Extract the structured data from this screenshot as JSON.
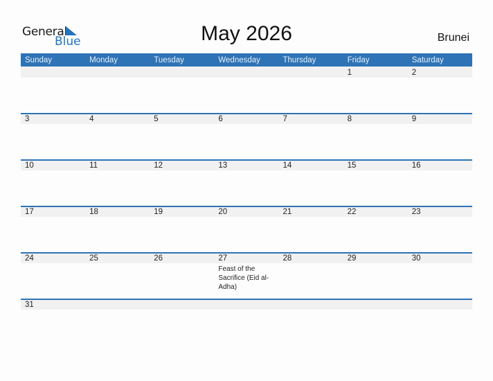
{
  "logo": {
    "word1": "General",
    "word2": "Blue",
    "icon": "triangle-flag-icon"
  },
  "title": "May 2026",
  "country": "Brunei",
  "colors": {
    "accent": "#2e73b5",
    "band": "#f1f1f1",
    "logo_blue": "#1f74c0"
  },
  "weekdays": [
    "Sunday",
    "Monday",
    "Tuesday",
    "Wednesday",
    "Thursday",
    "Friday",
    "Saturday"
  ],
  "weeks": [
    [
      {
        "d": ""
      },
      {
        "d": ""
      },
      {
        "d": ""
      },
      {
        "d": ""
      },
      {
        "d": ""
      },
      {
        "d": "1"
      },
      {
        "d": "2"
      }
    ],
    [
      {
        "d": "3"
      },
      {
        "d": "4"
      },
      {
        "d": "5"
      },
      {
        "d": "6"
      },
      {
        "d": "7"
      },
      {
        "d": "8"
      },
      {
        "d": "9"
      }
    ],
    [
      {
        "d": "10"
      },
      {
        "d": "11"
      },
      {
        "d": "12"
      },
      {
        "d": "13"
      },
      {
        "d": "14"
      },
      {
        "d": "15"
      },
      {
        "d": "16"
      }
    ],
    [
      {
        "d": "17"
      },
      {
        "d": "18"
      },
      {
        "d": "19"
      },
      {
        "d": "20"
      },
      {
        "d": "21"
      },
      {
        "d": "22"
      },
      {
        "d": "23"
      }
    ],
    [
      {
        "d": "24"
      },
      {
        "d": "25"
      },
      {
        "d": "26"
      },
      {
        "d": "27",
        "event": "Feast of the Sacrifice (Eid al-Adha)"
      },
      {
        "d": "28"
      },
      {
        "d": "29"
      },
      {
        "d": "30"
      }
    ],
    [
      {
        "d": "31"
      },
      {
        "d": ""
      },
      {
        "d": ""
      },
      {
        "d": ""
      },
      {
        "d": ""
      },
      {
        "d": ""
      },
      {
        "d": ""
      }
    ]
  ]
}
